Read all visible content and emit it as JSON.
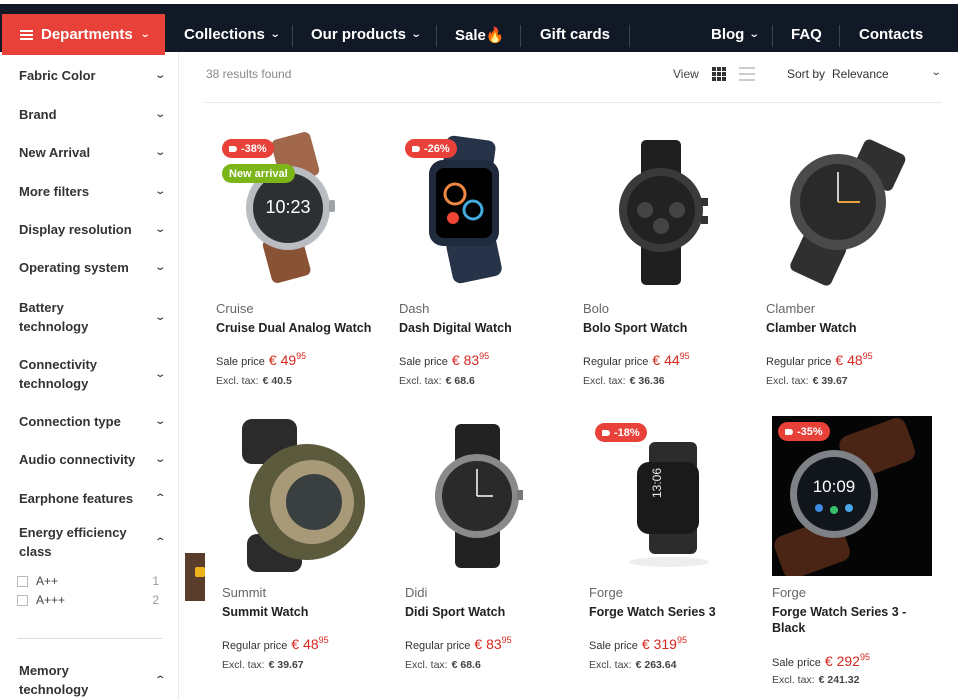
{
  "nav": {
    "departments": "Departments",
    "items": [
      "Collections",
      "Our products",
      "Sale🔥",
      "Gift cards",
      "Blog",
      "FAQ",
      "Contacts"
    ]
  },
  "filters": [
    {
      "label": "Fabric Color",
      "expanded": false
    },
    {
      "label": "Brand",
      "expanded": false
    },
    {
      "label": "New Arrival",
      "expanded": false
    },
    {
      "label": "More filters",
      "expanded": false
    },
    {
      "label": "Display resolution",
      "expanded": false
    },
    {
      "label": "Operating system",
      "expanded": false
    },
    {
      "label": "Battery technology",
      "expanded": false
    },
    {
      "label": "Connectivity technology",
      "expanded": false
    },
    {
      "label": "Connection type",
      "expanded": false
    },
    {
      "label": "Audio connectivity",
      "expanded": false
    },
    {
      "label": "Earphone features",
      "expanded": true
    },
    {
      "label": "Energy efficiency class",
      "expanded": true
    },
    {
      "label": "Memory technology",
      "expanded": true
    }
  ],
  "energy_options": [
    {
      "label": "A++",
      "count": "1"
    },
    {
      "label": "A+++",
      "count": "2"
    }
  ],
  "toolbar": {
    "results": "38 results found",
    "view_label": "View",
    "sort_label": "Sort by",
    "sort_value": "Relevance"
  },
  "products": [
    {
      "brand": "Cruise",
      "name": "Cruise Dual Analog Watch",
      "price_label": "Sale price",
      "price_main": "€ 49",
      "price_cents": "95",
      "tax_label": "Excl. tax:",
      "tax": "€ 40.5",
      "badges": [
        "-38%",
        "New arrival"
      ]
    },
    {
      "brand": "Dash",
      "name": "Dash Digital Watch",
      "price_label": "Sale price",
      "price_main": "€ 83",
      "price_cents": "95",
      "tax_label": "Excl. tax:",
      "tax": "€ 68.6",
      "badges": [
        "-26%"
      ]
    },
    {
      "brand": "Bolo",
      "name": "Bolo Sport Watch",
      "price_label": "Regular price",
      "price_main": "€ 44",
      "price_cents": "95",
      "tax_label": "Excl. tax:",
      "tax": "€ 36.36",
      "badges": []
    },
    {
      "brand": "Clamber",
      "name": "Clamber Watch",
      "price_label": "Regular price",
      "price_main": "€ 48",
      "price_cents": "95",
      "tax_label": "Excl. tax:",
      "tax": "€ 39.67",
      "badges": []
    },
    {
      "brand": "Summit",
      "name": "Summit Watch",
      "price_label": "Regular price",
      "price_main": "€ 48",
      "price_cents": "95",
      "tax_label": "Excl. tax:",
      "tax": "€ 39.67",
      "badges": []
    },
    {
      "brand": "Didi",
      "name": "Didi Sport Watch",
      "price_label": "Regular price",
      "price_main": "€ 83",
      "price_cents": "95",
      "tax_label": "Excl. tax:",
      "tax": "€ 68.6",
      "badges": []
    },
    {
      "brand": "Forge",
      "name": "Forge Watch Series 3",
      "price_label": "Sale price",
      "price_main": "€ 319",
      "price_cents": "95",
      "tax_label": "Excl. tax:",
      "tax": "€ 263.64",
      "badges": [
        "-18%"
      ]
    },
    {
      "brand": "Forge",
      "name": "Forge Watch Series 3 - Black",
      "price_label": "Sale price",
      "price_main": "€ 292",
      "price_cents": "95",
      "tax_label": "Excl. tax:",
      "tax": "€ 241.32",
      "badges": [
        "-35%"
      ]
    }
  ],
  "colors": {
    "accent": "#e8413a",
    "nav_bg": "#111826",
    "price": "#d6281f",
    "new_badge": "#7cb518"
  }
}
